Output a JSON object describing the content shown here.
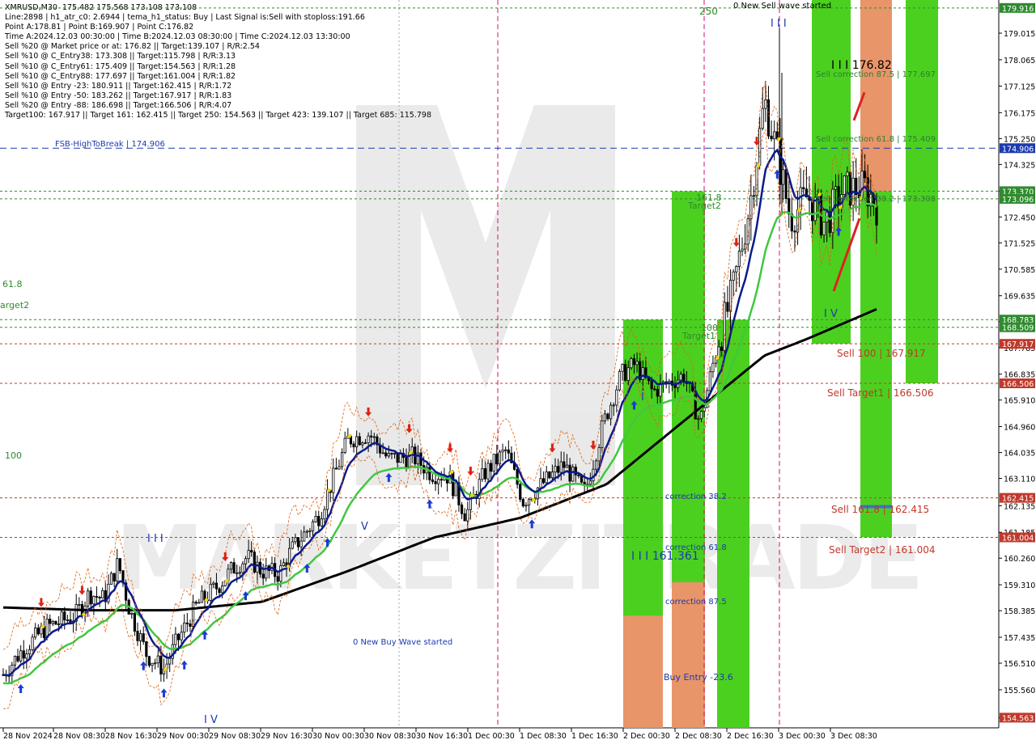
{
  "info_lines": [
    "XMRUSD,M30  175.482 175.568 173.108 173.108",
    "Line:2898 | h1_atr_c0: 2.6944 | tema_h1_status: Buy | Last Signal is:Sell with stoploss:191.66",
    "Point A:178.81 | Point B:169.907 | Point C:176.82",
    "Time A:2024.12.03 00:30:00 | Time B:2024.12.03 08:30:00 | Time C:2024.12.03 13:30:00",
    "Sell %20 @ Market price or at: 176.82 || Target:139.107 | R/R:2.54",
    "Sell %10 @ C_Entry38: 173.308 || Target:115.798 | R/R:3.13",
    "Sell %10 @ C_Entry61: 175.409 || Target:154.563 | R/R:1.28",
    "Sell %10 @ C_Entry88: 177.697 || Target:161.004 | R/R:1.82",
    "Sell %10 @ Entry -23: 180.911 || Target:162.415 | R/R:1.72",
    "Sell %10 @ Entry -50: 183.262 || Target:167.917 | R/R:1.83",
    "Sell %20 @ Entry -88: 186.698 || Target:166.506 | R/R:4.07",
    "Target100: 167.917 || Target 161: 162.415 || Target 250: 154.563 || Target 423: 139.107 || Target 685: 115.798"
  ],
  "chart_data": {
    "type": "candlestick",
    "symbol": "XMRUSD",
    "timeframe": "M30",
    "ylim": [
      154.2,
      180.2
    ],
    "y_ticks": [
      "179.015",
      "178.065",
      "177.125",
      "176.175",
      "175.250",
      "174.325",
      "173.375",
      "172.450",
      "171.525",
      "170.585",
      "169.635",
      "168.710",
      "167.785",
      "166.835",
      "165.910",
      "164.960",
      "164.035",
      "163.110",
      "162.135",
      "161.185",
      "160.260",
      "159.310",
      "158.385",
      "157.435",
      "156.510",
      "155.560",
      "154.563"
    ],
    "x_labels": [
      "28 Nov 2024",
      "28 Nov 08:30",
      "28 Nov 16:30",
      "29 Nov 00:30",
      "29 Nov 08:30",
      "29 Nov 16:30",
      "30 Nov 00:30",
      "30 Nov 08:30",
      "30 Nov 16:30",
      "1 Dec 00:30",
      "1 Dec 08:30",
      "1 Dec 16:30",
      "2 Dec 00:30",
      "2 Dec 08:30",
      "2 Dec 16:30",
      "3 Dec 00:30",
      "3 Dec 08:30"
    ],
    "price_tags": [
      {
        "value": 179.916,
        "label": "179.916",
        "color": "#2e8b2e"
      },
      {
        "value": 174.906,
        "label": "174.906",
        "color": "#1a3ab0"
      },
      {
        "value": 173.37,
        "label": "173.370",
        "color": "#2e8b2e"
      },
      {
        "value": 173.096,
        "label": "173.096",
        "color": "#2e8b2e"
      },
      {
        "value": 168.783,
        "label": "168.783",
        "color": "#2e8b2e"
      },
      {
        "value": 168.509,
        "label": "168.509",
        "color": "#2e8b2e"
      },
      {
        "value": 167.917,
        "label": "167.917",
        "color": "#c0392b"
      },
      {
        "value": 166.506,
        "label": "166.506",
        "color": "#c0392b"
      },
      {
        "value": 162.415,
        "label": "162.415",
        "color": "#c0392b"
      },
      {
        "value": 161.004,
        "label": "161.004",
        "color": "#c0392b"
      },
      {
        "value": 154.563,
        "label": "154.563",
        "color": "#c0392b"
      }
    ],
    "annotations": [
      {
        "text": "FSB-HighToBreak  |  174.906",
        "color": "#1a3ab0"
      },
      {
        "text": "0 New Sell wave started",
        "color": "#000"
      },
      {
        "text": "0 New Buy Wave started",
        "color": "#1a3ab0"
      },
      {
        "text": "I I I  176.82",
        "color": "#000"
      },
      {
        "text": "Sell correction 87.5 | 177.697",
        "color": "#2e7d32"
      },
      {
        "text": "Sell correction 61.8 | 175.409",
        "color": "#2e7d32"
      },
      {
        "text": "Sell correction 38.2 | 173.308",
        "color": "#2e7d32"
      },
      {
        "text": "Sell 100 | 167.917",
        "color": "#c0392b"
      },
      {
        "text": "Sell Target1 | 166.506",
        "color": "#c0392b"
      },
      {
        "text": "Sell 161.8 | 162.415",
        "color": "#c0392b"
      },
      {
        "text": "Sell Target2 | 161.004",
        "color": "#c0392b"
      },
      {
        "text": "I I I  161.361",
        "color": "#1a3ab0"
      },
      {
        "text": "correction 38.2",
        "color": "#1a3ab0"
      },
      {
        "text": "correction 61.8",
        "color": "#1a3ab0"
      },
      {
        "text": "correction 87.5",
        "color": "#1a3ab0"
      },
      {
        "text": "Buy Entry -23.6",
        "color": "#1a3ab0"
      },
      {
        "text": "Target1",
        "color": "#2e8b2e"
      },
      {
        "text": "Target2",
        "color": "#2e8b2e"
      },
      {
        "text": "161.8",
        "color": "#2e8b2e"
      },
      {
        "text": "100",
        "color": "#2e8b2e"
      },
      {
        "text": "250",
        "color": "#2e8b2e"
      },
      {
        "text": "61.8",
        "color": "#2e8b2e"
      },
      {
        "text": "arget2",
        "color": "#2e8b2e"
      },
      {
        "text": "100",
        "color": "#2e8b2e"
      },
      {
        "text": "I",
        "color": "#1a3ab0"
      },
      {
        "text": "I I I",
        "color": "#1a3ab0"
      },
      {
        "text": "V",
        "color": "#1a3ab0"
      },
      {
        "text": "I V",
        "color": "#1a3ab0"
      },
      {
        "text": "I V",
        "color": "#1a3ab0"
      },
      {
        "text": "I I I",
        "color": "#1a3ab0"
      }
    ],
    "watermark": "MARKETZITRADE",
    "colors": {
      "candle": "#000000",
      "ma_fast": "#0b1a8c",
      "ma_mid": "#3fc83f",
      "ma_slow": "#000000",
      "band_green": "#4cd020",
      "band_orange": "#e8956a",
      "sell_line": "#c0392b",
      "buy_line": "#1a3ab0"
    }
  }
}
